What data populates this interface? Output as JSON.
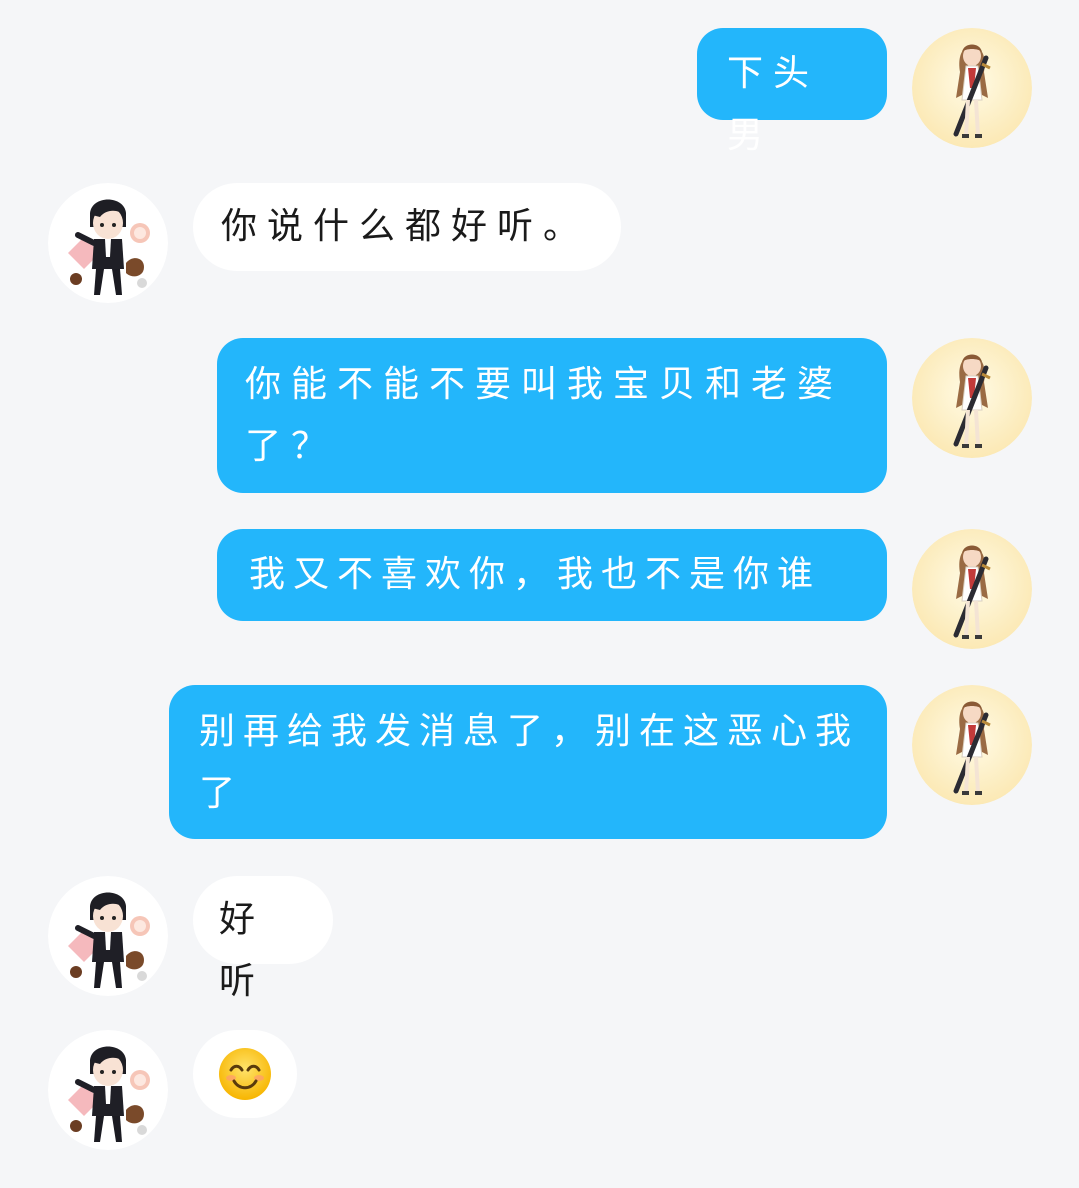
{
  "colors": {
    "background": "#f5f6f8",
    "sent_bubble": "#23b6fb",
    "received_bubble": "#ffffff"
  },
  "messages": [
    {
      "side": "sent",
      "text": "下头男",
      "avatar": "girl-avatar"
    },
    {
      "side": "received",
      "text": "你说什么都好听。",
      "avatar": "boy-avatar"
    },
    {
      "side": "sent",
      "text": "你能不能不要叫我宝贝和老婆了？",
      "avatar": "girl-avatar"
    },
    {
      "side": "sent",
      "text": "我又不喜欢你，我也不是你谁",
      "avatar": "girl-avatar"
    },
    {
      "side": "sent",
      "text": "别再给我发消息了，别在这恶心我了",
      "avatar": "girl-avatar"
    },
    {
      "side": "received",
      "text": "好听",
      "avatar": "boy-avatar"
    },
    {
      "side": "received",
      "emoji": "smiling-face-emoji",
      "avatar": "boy-avatar"
    }
  ]
}
